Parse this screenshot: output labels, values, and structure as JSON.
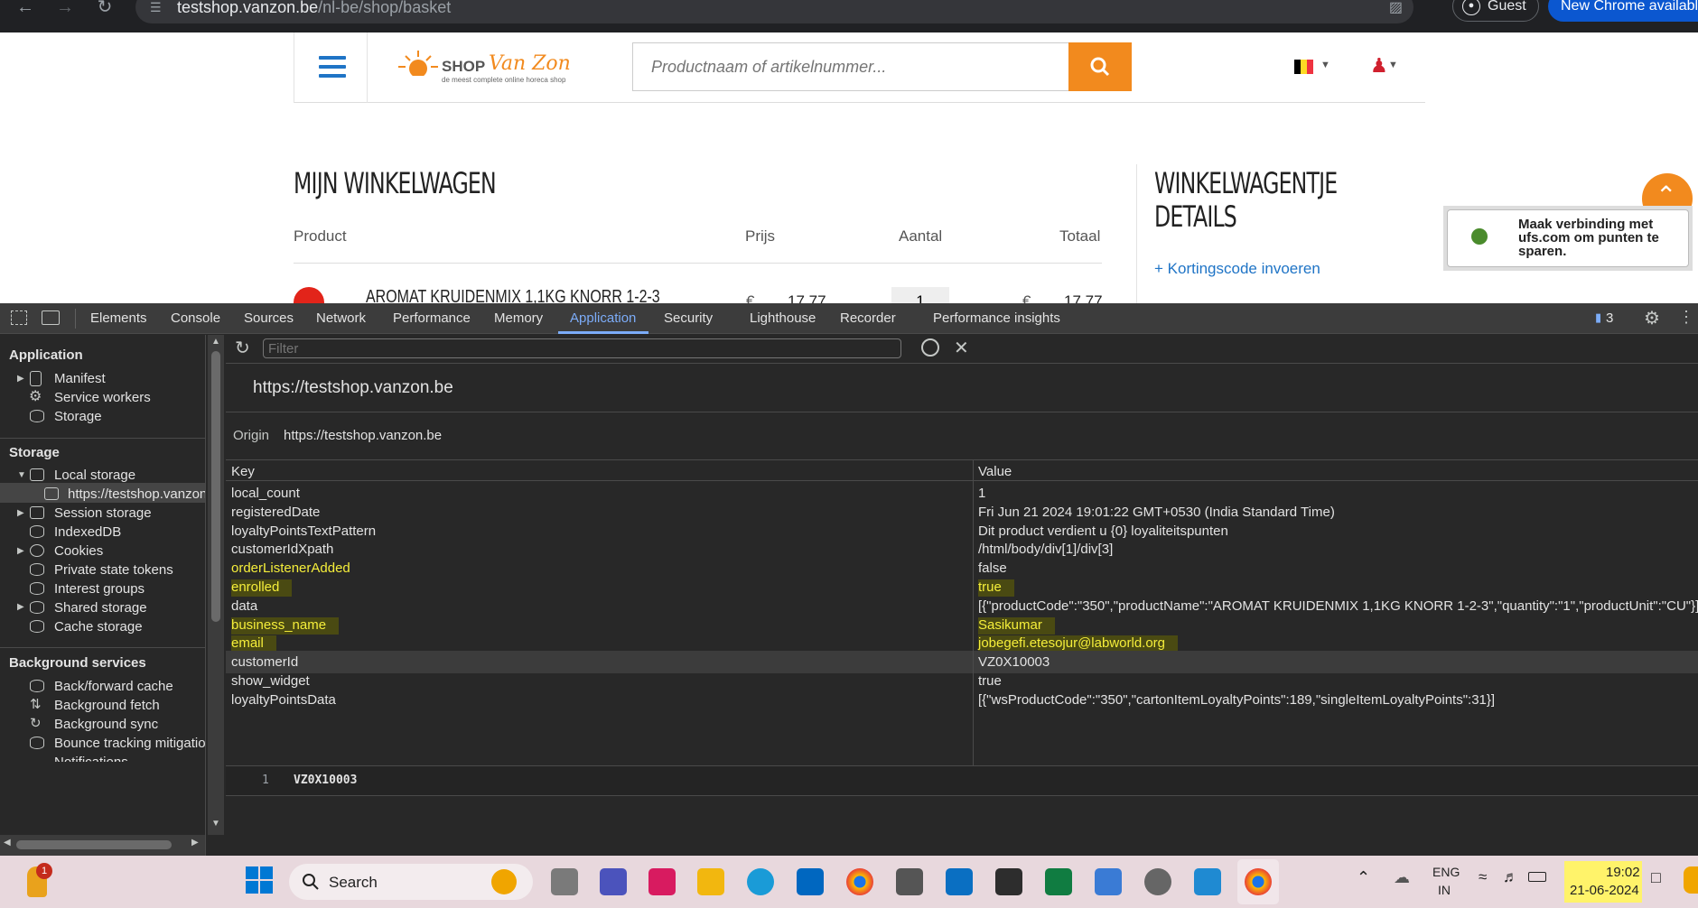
{
  "browser": {
    "url_host": "testshop.vanzon.be",
    "url_path": "/nl-be/shop/basket",
    "guest_label": "Guest",
    "update_label": "New Chrome available"
  },
  "site": {
    "logo_text": "SHOP",
    "logo_brand": "Van Zon",
    "logo_tagline": "de meest complete online horeca shop",
    "search_placeholder": "Productnaam of artikelnummer...",
    "cart_title": "MIJN WINKELWAGEN",
    "columns": {
      "product": "Product",
      "price": "Prijs",
      "qty": "Aantal",
      "total": "Totaal"
    },
    "item_name": "AROMAT KRUIDENMIX 1,1KG KNORR 1-2-3",
    "item_price": "17,77",
    "item_qty": "1",
    "item_total": "17,77",
    "currency": "€",
    "details_title_1": "WINKELWAGENTJE",
    "details_title_2": "DETAILS",
    "discount_link": "+ Kortingscode invoeren",
    "popup_text": "Maak verbinding met ufs.com om punten te sparen."
  },
  "devtools": {
    "tabs": [
      "Elements",
      "Console",
      "Sources",
      "Network",
      "Performance",
      "Memory",
      "Application",
      "Security",
      "Lighthouse",
      "Recorder",
      "Performance insights"
    ],
    "issues_count": "3",
    "filter_placeholder": "Filter",
    "sidebar": {
      "app_head": "Application",
      "app_items": [
        "Manifest",
        "Service workers",
        "Storage"
      ],
      "storage_head": "Storage",
      "local_storage": "Local storage",
      "local_origin": "https://testshop.vanzon.be",
      "storage_items": [
        "Session storage",
        "IndexedDB",
        "Cookies",
        "Private state tokens",
        "Interest groups",
        "Shared storage",
        "Cache storage"
      ],
      "bg_head": "Background services",
      "bg_items": [
        "Back/forward cache",
        "Background fetch",
        "Background sync",
        "Bounce tracking mitigations",
        "Notifications"
      ]
    },
    "origin_title": "https://testshop.vanzon.be",
    "origin_label": "Origin",
    "origin_value": "https://testshop.vanzon.be",
    "col_key": "Key",
    "col_value": "Value",
    "rows": [
      {
        "k": "local_count",
        "v": "1"
      },
      {
        "k": "registeredDate",
        "v": "Fri Jun 21 2024 19:01:22 GMT+0530 (India Standard Time)"
      },
      {
        "k": "loyaltyPointsTextPattern",
        "v": "Dit product verdient u {0} loyaliteitspunten"
      },
      {
        "k": "customerIdXpath",
        "v": "/html/body/div[1]/div[3]"
      },
      {
        "k": "orderListenerAdded",
        "v": "false"
      },
      {
        "k": "enrolled",
        "v": "true"
      },
      {
        "k": "data",
        "v": "[{\"productCode\":\"350\",\"productName\":\"AROMAT KRUIDENMIX 1,1KG KNORR 1-2-3\",\"quantity\":\"1\",\"productUnit\":\"CU\"}]"
      },
      {
        "k": "business_name",
        "v": "Sasikumar"
      },
      {
        "k": "email",
        "v": "jobegefi.etesojur@labworld.org"
      },
      {
        "k": "customerId",
        "v": "VZ0X10003"
      },
      {
        "k": "show_widget",
        "v": "true"
      },
      {
        "k": "loyaltyPointsData",
        "v": "[{\"wsProductCode\":\"350\",\"cartonItemLoyaltyPoints\":189,\"singleItemLoyaltyPoints\":31}]"
      }
    ],
    "preview_line": "1",
    "preview_value": "VZ0X10003"
  },
  "taskbar": {
    "search_label": "Search",
    "badge": "1",
    "lang_1": "ENG",
    "lang_2": "IN",
    "time": "19:02",
    "date": "21-06-2024"
  }
}
